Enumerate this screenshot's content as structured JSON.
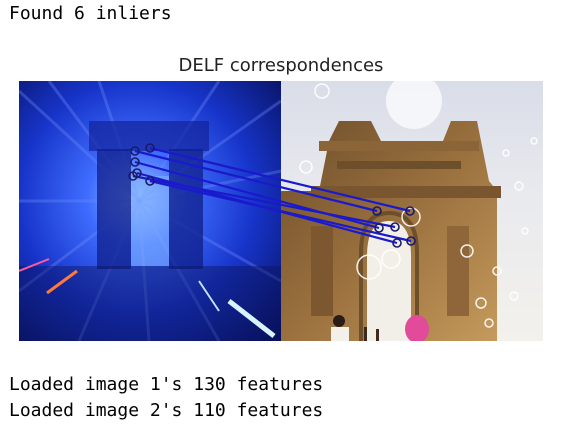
{
  "output": {
    "inliers_line": "Found 6 inliers",
    "features_line_1": "Loaded image 1's 130 features",
    "features_line_2": "Loaded image 2's 110 features"
  },
  "figure": {
    "title": "DELF correspondences",
    "image_1": {
      "subject": "motion-blurred arch, blue tint",
      "dominant_color": "#1f3fd6"
    },
    "image_2": {
      "subject": "stone arch monument under bright sky",
      "dominant_color": "#a8793f"
    },
    "match_color": "#1a1acc",
    "keypoint_color": "#1a1a66",
    "num_matches": 6
  }
}
